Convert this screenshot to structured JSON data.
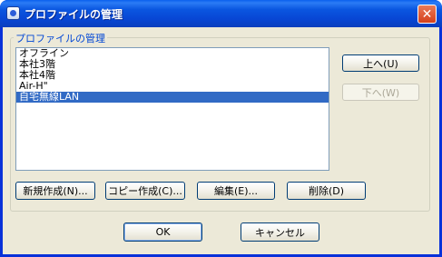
{
  "window": {
    "title": "プロファイルの管理",
    "close_glyph": "✕"
  },
  "group": {
    "label": "プロファイルの管理"
  },
  "profiles": [
    "オフライン",
    "本社3階",
    "本社4階",
    "Air-H\"",
    "自宅無線LAN"
  ],
  "selected_index": 4,
  "side_buttons": {
    "up": "上へ(U)",
    "down": "下へ(W)"
  },
  "action_buttons": {
    "new": "新規作成(N)...",
    "copy": "コピー作成(C)...",
    "edit": "編集(E)...",
    "delete": "削除(D)"
  },
  "dialog_buttons": {
    "ok": "OK",
    "cancel": "キャンセル"
  }
}
